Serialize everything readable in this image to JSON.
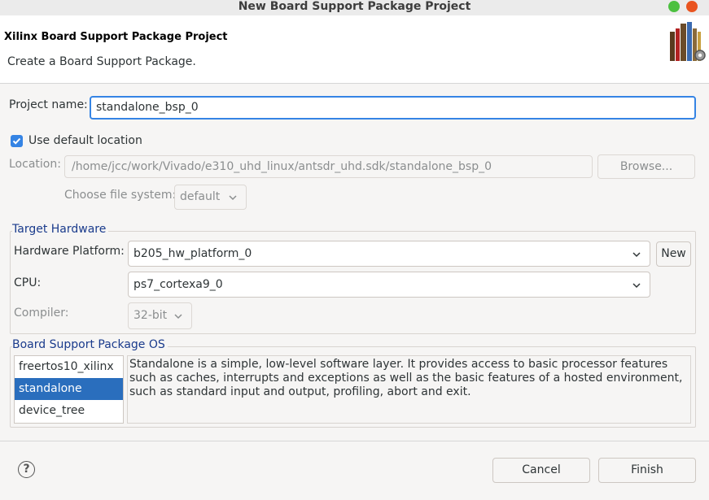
{
  "window": {
    "title": "New Board Support Package Project"
  },
  "banner": {
    "title": "Xilinx Board Support Package Project",
    "description": "Create a Board Support Package."
  },
  "project": {
    "name_label": "Project name:",
    "name_value": "standalone_bsp_0",
    "use_default_label": "Use default location",
    "use_default_checked": true,
    "location_label": "Location:",
    "location_value": "/home/jcc/work/Vivado/e310_uhd_linux/antsdr_uhd.sdk/standalone_bsp_0",
    "browse_label": "Browse...",
    "filesystem_label": "Choose file system:",
    "filesystem_value": "default"
  },
  "target_hardware": {
    "group_title": "Target Hardware",
    "platform_label": "Hardware Platform:",
    "platform_value": "b205_hw_platform_0",
    "new_label": "New",
    "cpu_label": "CPU:",
    "cpu_value": "ps7_cortexa9_0",
    "compiler_label": "Compiler:",
    "compiler_value": "32-bit"
  },
  "bsp_os": {
    "group_title": "Board Support Package OS",
    "items": [
      "freertos10_xilinx",
      "standalone",
      "device_tree"
    ],
    "selected": "standalone",
    "description": "Standalone is a simple, low-level software layer. It provides access to basic processor features such as caches, interrupts and exceptions as well as the basic features of a hosted environment, such as standard input and output, profiling, abort and exit."
  },
  "footer": {
    "help_glyph": "?",
    "cancel_label": "Cancel",
    "finish_label": "Finish"
  },
  "colors": {
    "accent": "#3584e4",
    "selection": "#2a6ebd",
    "group_title": "#1a3b8c",
    "close_button": "#e95420",
    "minimize_button": "#4cc040"
  }
}
